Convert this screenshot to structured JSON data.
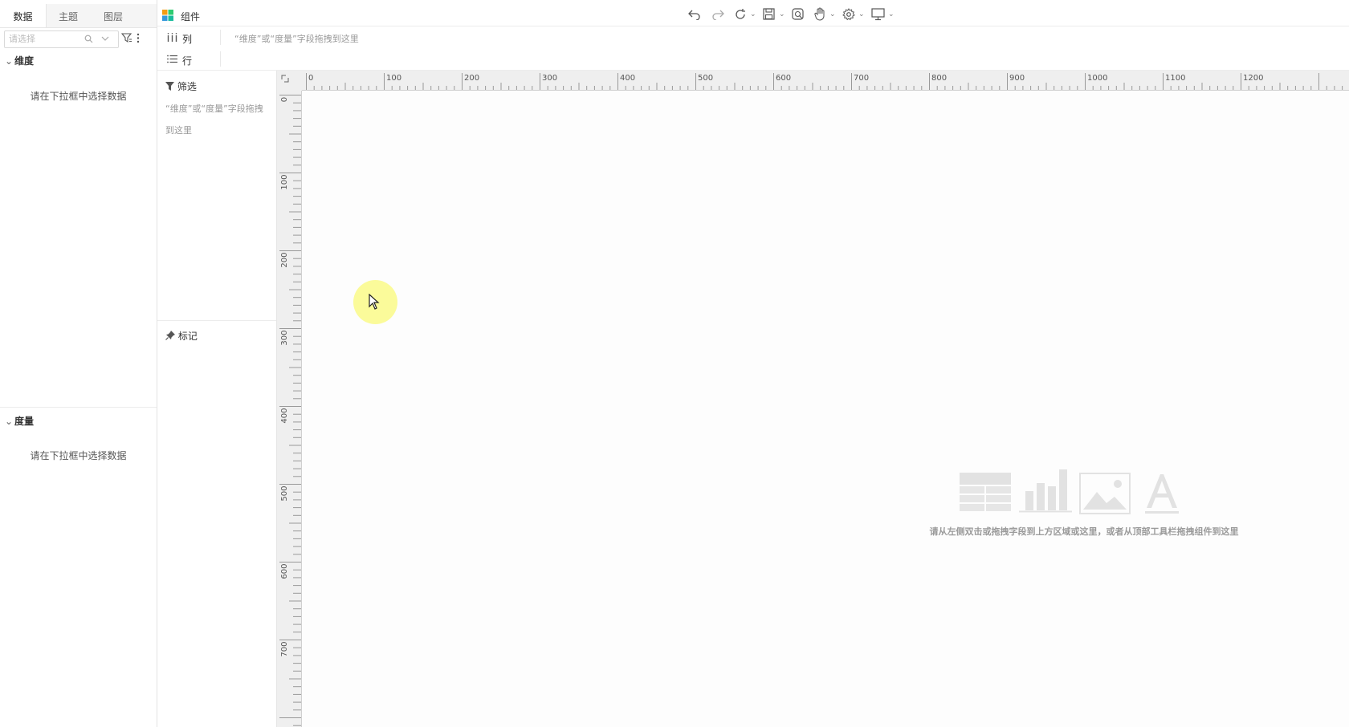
{
  "left_panel": {
    "tabs": [
      {
        "label": "数据",
        "active": true
      },
      {
        "label": "主题",
        "active": false
      },
      {
        "label": "图层",
        "active": false
      }
    ],
    "search": {
      "placeholder": "请选择"
    },
    "dimension": {
      "title": "维度",
      "empty_hint": "请在下拉框中选择数据"
    },
    "measure": {
      "title": "度量",
      "empty_hint": "请在下拉框中选择数据"
    }
  },
  "toolbar": {
    "component_label": "组件",
    "icons": [
      "undo-icon",
      "redo-icon",
      "refresh-icon",
      "save-icon",
      "preview-icon",
      "hand-icon",
      "settings-icon",
      "monitor-icon"
    ]
  },
  "shelves": {
    "columns": {
      "label": "列",
      "drop_hint": "“维度”或“度量”字段拖拽到这里"
    },
    "rows": {
      "label": "行"
    }
  },
  "filter_panel": {
    "title": "筛选",
    "hint": "“维度”或“度量”字段拖拽到这里",
    "mark_title": "标记"
  },
  "rulers": {
    "top_labels": [
      "0",
      "100",
      "200",
      "300",
      "400",
      "500",
      "600",
      "700",
      "800",
      "900",
      "1000",
      "1100",
      "1200"
    ],
    "left_labels": [
      "0",
      "100",
      "200",
      "300",
      "400",
      "500",
      "600",
      "700"
    ]
  },
  "canvas": {
    "empty_message": "请从左侧双击或拖拽字段到上方区域或这里，或者从顶部工具栏拖拽组件到这里"
  },
  "colors": {
    "accent_blue": "#1f8ceb",
    "logo_orange": "#f39c12",
    "logo_green": "#2ecc71",
    "logo_blue": "#3498db",
    "logo_teal": "#1abc9c"
  }
}
